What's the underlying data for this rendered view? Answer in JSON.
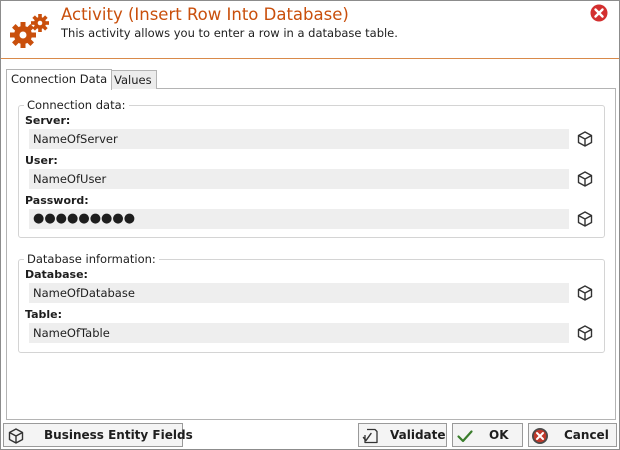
{
  "header": {
    "title": "Activity (Insert Row Into Database)",
    "subtitle": "This activity allows you to enter a row in a database table."
  },
  "tabs": [
    {
      "label": "Connection Data",
      "active": true
    },
    {
      "label": "Values",
      "active": false
    }
  ],
  "connection_group": {
    "legend": "Connection data:",
    "server_label": "Server:",
    "server_value": "NameOfServer",
    "user_label": "User:",
    "user_value": "NameOfUser",
    "password_label": "Password:",
    "password_value": "●●●●●●●●●"
  },
  "database_group": {
    "legend": "Database information:",
    "database_label": "Database:",
    "database_value": "NameOfDatabase",
    "table_label": "Table:",
    "table_value": "NameOfTable"
  },
  "footer": {
    "business_entity_label": "Business Entity Fields",
    "validate_label": "Validate",
    "ok_label": "OK",
    "cancel_label": "Cancel"
  },
  "colors": {
    "accent": "#c94f0c",
    "close": "#d32f2f",
    "ok_check": "#3a7d2c"
  }
}
